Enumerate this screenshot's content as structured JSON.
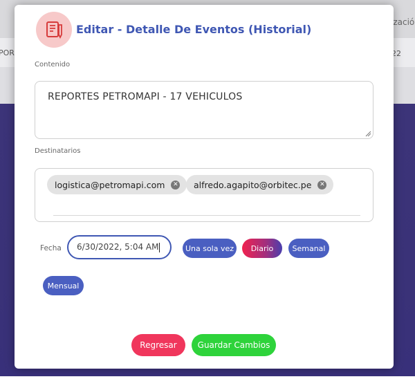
{
  "background": {
    "left_fragment": "POR",
    "right_fragment_1": "ización",
    "right_fragment_2": "22"
  },
  "modal": {
    "title": "Editar - Detalle De Eventos (Historial)",
    "icon": "report-edit-icon",
    "contenido_label": "Contenido",
    "contenido_value": "REPORTES PETROMAPI - 17 VEHICULOS",
    "destinatarios_label": "Destinatarios",
    "recipients": [
      "logistica@petromapi.com",
      "alfredo.agapito@orbitec.pe"
    ],
    "fecha_label": "Fecha",
    "fecha_value": "6/30/2022, 5:04 AM",
    "frequency": {
      "options": [
        "Una sola vez",
        "Diario",
        "Semanal",
        "Mensual"
      ],
      "selected": "Diario"
    },
    "buttons": {
      "back": "Regresar",
      "save": "Guardar Cambios"
    }
  },
  "colors": {
    "accent_blue": "#3f57b3",
    "pill_blue": "#4a5fc1",
    "selected_gradient_start": "#f0224f",
    "selected_gradient_end": "#4a3fae",
    "back_button": "#f0365c",
    "save_button": "#2ed33b",
    "backdrop": "#3b3379"
  }
}
